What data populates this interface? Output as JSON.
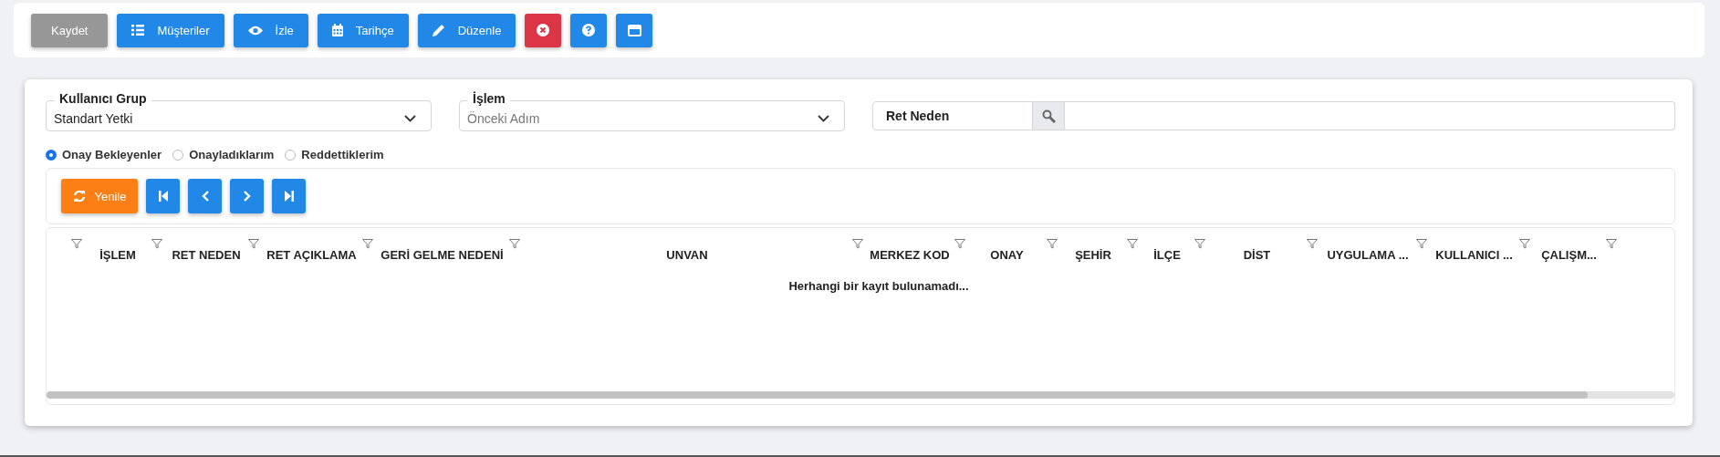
{
  "toolbar": [
    {
      "label": "Kaydet",
      "kind": "save"
    },
    {
      "label": "Müşteriler",
      "kind": "list"
    },
    {
      "label": "İzle",
      "kind": "eye"
    },
    {
      "label": "Tarihçe",
      "kind": "calendar"
    },
    {
      "label": "Düzenle",
      "kind": "pencil"
    },
    {
      "kind": "close"
    },
    {
      "kind": "help"
    },
    {
      "kind": "window"
    }
  ],
  "filters": {
    "user_group": {
      "label": "Kullanıcı Grup",
      "value": "Standart Yetki"
    },
    "operation": {
      "label": "İşlem",
      "placeholder": "Önceki Adım"
    },
    "reject_reason": {
      "label": "Ret Neden"
    }
  },
  "radios": [
    {
      "label": "Onay Bekleyenler",
      "selected": true
    },
    {
      "label": "Onayladıklarım",
      "selected": false
    },
    {
      "label": "Reddettiklerim",
      "selected": false
    }
  ],
  "grid_toolbar": [
    {
      "label": "Yenile",
      "kind": "refresh"
    },
    {
      "kind": "first"
    },
    {
      "kind": "prev"
    },
    {
      "kind": "next"
    },
    {
      "kind": "last"
    }
  ],
  "table": {
    "columns": [
      "İŞLEM",
      "RET NEDEN",
      "RET AÇIKLAMA",
      "GERİ GELME NEDENİ",
      "UNVAN",
      "MERKEZ KOD",
      "ONAY",
      "ŞEHİR",
      "İLÇE",
      "DİST",
      "UYGULAMA ...",
      "KULLANICI ...",
      "ÇALIŞM..."
    ],
    "empty_message": "Herhangi bir kayıt bulunamadı..."
  }
}
